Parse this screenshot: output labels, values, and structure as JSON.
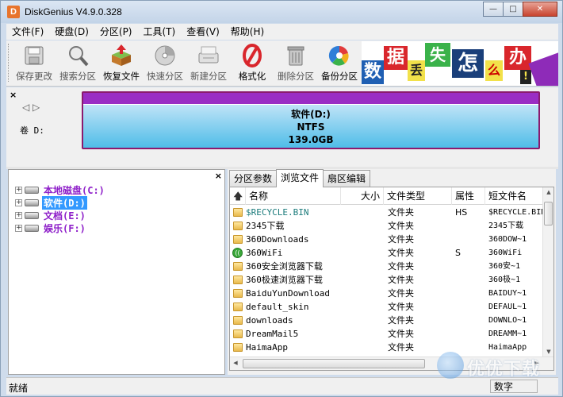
{
  "window": {
    "title": "DiskGenius V4.9.0.328",
    "app_icon_letter": "D",
    "buttons": {
      "minimize": "—",
      "maximize": "□",
      "close": "✕"
    }
  },
  "menu": [
    "文件(F)",
    "硬盘(D)",
    "分区(P)",
    "工具(T)",
    "查看(V)",
    "帮助(H)"
  ],
  "toolbar": {
    "items": [
      {
        "label": "保存更改",
        "icon": "save-icon",
        "active": false
      },
      {
        "label": "搜索分区",
        "icon": "magnifier-icon",
        "active": false
      },
      {
        "label": "恢复文件",
        "icon": "recover-box-icon",
        "active": true
      },
      {
        "label": "快速分区",
        "icon": "quick-partition-icon",
        "active": false
      },
      {
        "label": "新建分区",
        "icon": "new-partition-icon",
        "active": false
      },
      {
        "label": "格式化",
        "icon": "format-icon",
        "active": true
      },
      {
        "label": "删除分区",
        "icon": "trash-icon",
        "active": false
      },
      {
        "label": "备份分区",
        "icon": "backup-icon",
        "active": true
      }
    ],
    "banner_chars": [
      "数",
      "据",
      "丢",
      "失",
      "怎",
      "么",
      "办",
      "!"
    ]
  },
  "disk": {
    "close_label": "×",
    "nav_arrows": "◁ ▷",
    "volume_label": "卷 D:",
    "partition": {
      "name": "软件(D:)",
      "fs": "NTFS",
      "size": "139.0GB"
    },
    "colors": {
      "border": "#8b1a6e",
      "top_strip": "#9a2dc4",
      "partition": "#4fbde8"
    }
  },
  "tree": {
    "close_label": "×",
    "items": [
      {
        "label": "本地磁盘(C:)",
        "selected": false
      },
      {
        "label": "软件(D:)",
        "selected": true
      },
      {
        "label": "文档(E:)",
        "selected": false
      },
      {
        "label": "娱乐(F:)",
        "selected": false
      }
    ]
  },
  "tabs": [
    "分区参数",
    "浏览文件",
    "扇区编辑"
  ],
  "active_tab": "浏览文件",
  "file_columns": [
    "名称",
    "大小",
    "文件类型",
    "属性",
    "短文件名"
  ],
  "files": [
    {
      "name": "$RECYCLE.BIN",
      "type": "文件夹",
      "attr": "HS",
      "short": "$RECYCLE.BIN",
      "icon": "folder-icon",
      "sys": true
    },
    {
      "name": "2345下载",
      "type": "文件夹",
      "attr": "",
      "short": "2345下载",
      "icon": "folder-icon",
      "sys": false
    },
    {
      "name": "360Downloads",
      "type": "文件夹",
      "attr": "",
      "short": "360DOW~1",
      "icon": "folder-icon",
      "sys": false
    },
    {
      "name": "360WiFi",
      "type": "文件夹",
      "attr": "S",
      "short": "360WiFi",
      "icon": "wifi-icon",
      "sys": false
    },
    {
      "name": "360安全浏览器下载",
      "type": "文件夹",
      "attr": "",
      "short": "360安~1",
      "icon": "folder-icon",
      "sys": false
    },
    {
      "name": "360极速浏览器下载",
      "type": "文件夹",
      "attr": "",
      "short": "360极~1",
      "icon": "folder-icon",
      "sys": false
    },
    {
      "name": "BaiduYunDownload",
      "type": "文件夹",
      "attr": "",
      "short": "BAIDUY~1",
      "icon": "folder-icon",
      "sys": false
    },
    {
      "name": "default_skin",
      "type": "文件夹",
      "attr": "",
      "short": "DEFAUL~1",
      "icon": "folder-icon",
      "sys": false
    },
    {
      "name": "downloads",
      "type": "文件夹",
      "attr": "",
      "short": "DOWNLO~1",
      "icon": "folder-icon",
      "sys": false
    },
    {
      "name": "DreamMail5",
      "type": "文件夹",
      "attr": "",
      "short": "DREAMM~1",
      "icon": "folder-icon",
      "sys": false
    },
    {
      "name": "HaimaApp",
      "type": "文件夹",
      "attr": "",
      "short": "HaimaApp",
      "icon": "folder-icon",
      "sys": false
    }
  ],
  "status": {
    "left": "就绪",
    "right": "数字"
  },
  "watermark": "优优下载"
}
